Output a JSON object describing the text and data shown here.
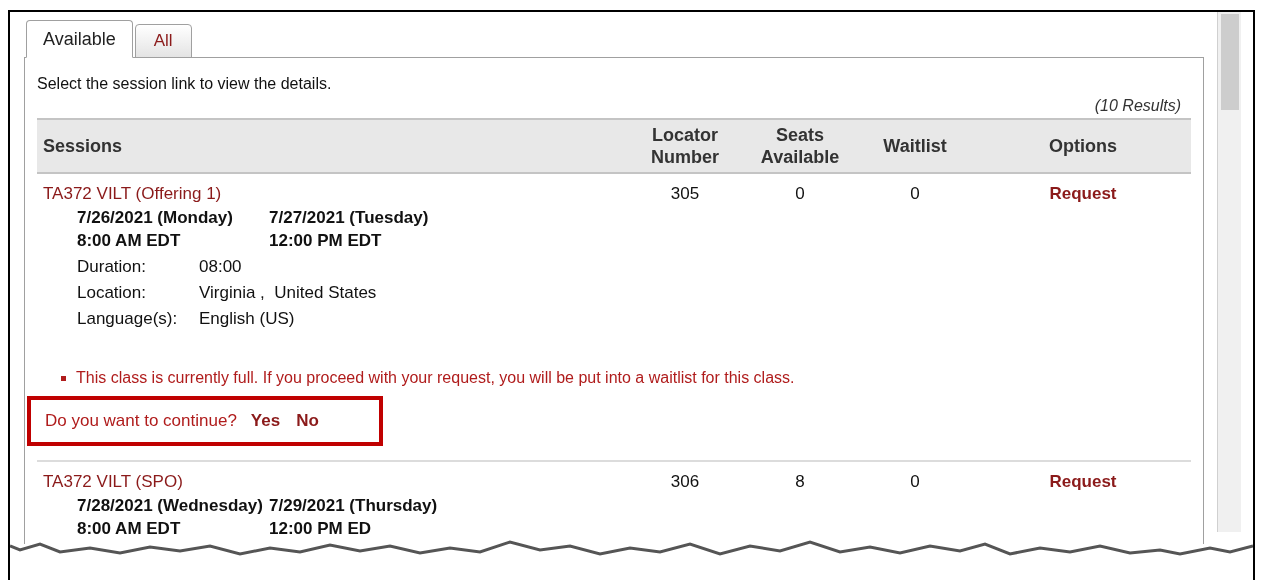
{
  "tabs": [
    {
      "label": "Available",
      "selected": true
    },
    {
      "label": "All",
      "selected": false
    }
  ],
  "instruction": "Select the session link to view the details.",
  "results_count": "(10 Results)",
  "table": {
    "columns": [
      "Sessions",
      "Locator Number",
      "Seats Available",
      "Waitlist",
      "Options"
    ],
    "rows": [
      {
        "title": "TA372 VILT (Offering 1)",
        "start_date": "7/26/2021 (Monday)",
        "end_date": "7/27/2021 (Tuesday)",
        "start_time": "8:00 AM EDT",
        "end_time": "12:00 PM EDT",
        "details": [
          {
            "label": "Duration:",
            "value": "08:00"
          },
          {
            "label": "Location:",
            "value": "Virginia ,  United States"
          },
          {
            "label": "Language(s):",
            "value": "English (US)"
          }
        ],
        "locator": "305",
        "seats": "0",
        "waitlist": "0",
        "option": "Request",
        "warning": "This class is currently full. If you proceed with your request, you will be put into a waitlist for this class.",
        "confirm": {
          "question": "Do you want to continue?",
          "yes": "Yes",
          "no": "No"
        }
      },
      {
        "title": "TA372 VILT (SPO)",
        "start_date": "7/28/2021 (Wednesday)",
        "end_date": "7/29/2021 (Thursday)",
        "start_time": "8:00 AM EDT",
        "end_time": "12:00 PM ED",
        "locator": "306",
        "seats": "8",
        "waitlist": "0",
        "option": "Request"
      }
    ]
  }
}
